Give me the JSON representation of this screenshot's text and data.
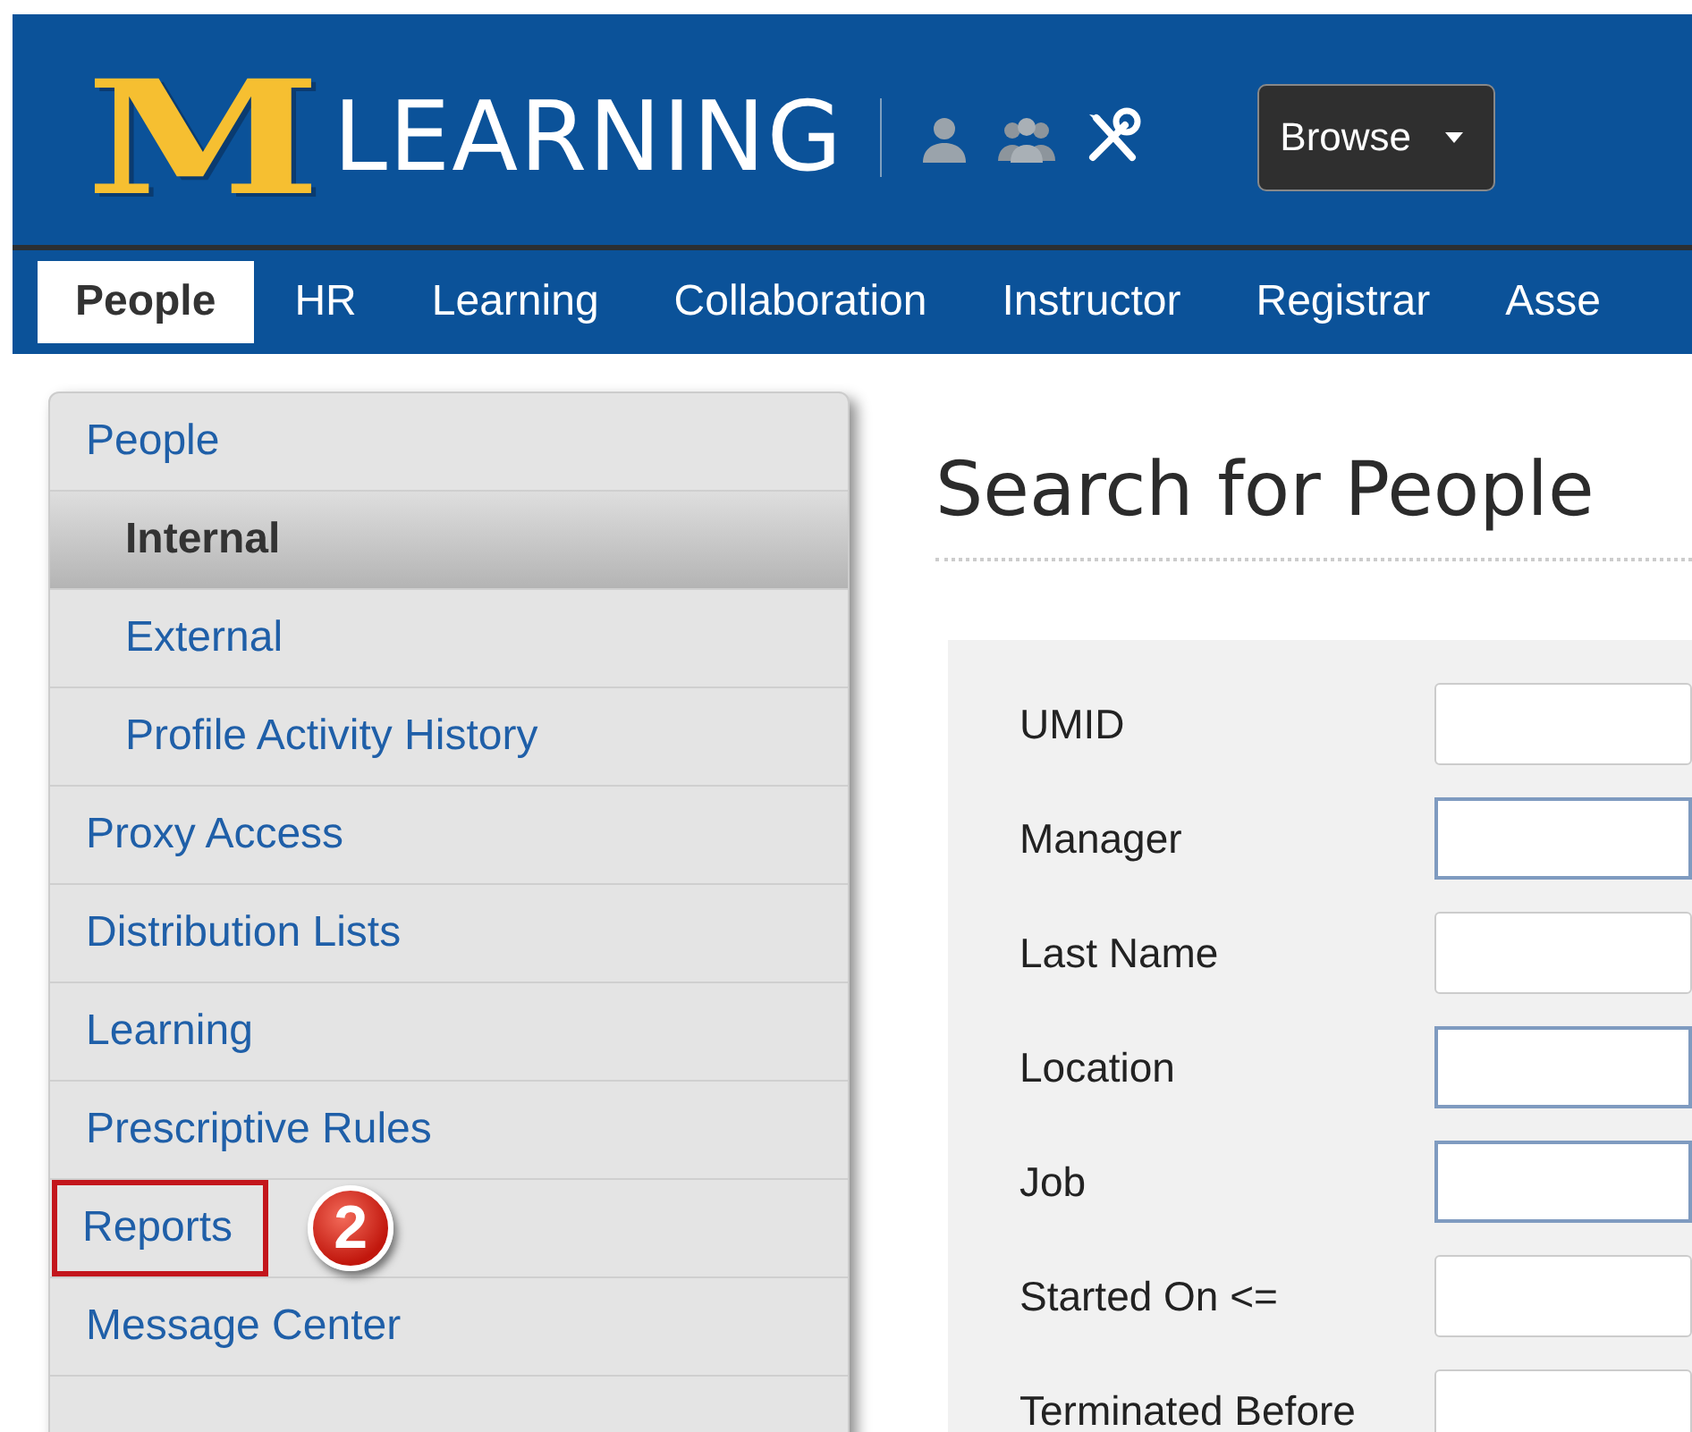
{
  "header": {
    "logo_mark": "M",
    "logo_text": "LEARNING",
    "browse_button": "Browse"
  },
  "tabs": [
    {
      "label": "People",
      "selected": true
    },
    {
      "label": "HR",
      "selected": false
    },
    {
      "label": "Learning",
      "selected": false
    },
    {
      "label": "Collaboration",
      "selected": false
    },
    {
      "label": "Instructor",
      "selected": false
    },
    {
      "label": "Registrar",
      "selected": false
    },
    {
      "label": "Asse",
      "selected": false
    }
  ],
  "sidebar": {
    "items": [
      {
        "label": "People",
        "selected": false,
        "highlighted": false,
        "children": [
          {
            "label": "Internal",
            "selected": true,
            "highlighted": false
          },
          {
            "label": "External",
            "selected": false,
            "highlighted": false
          },
          {
            "label": "Profile Activity History",
            "selected": false,
            "highlighted": false
          }
        ]
      },
      {
        "label": "Proxy Access",
        "selected": false,
        "highlighted": false
      },
      {
        "label": "Distribution Lists",
        "selected": false,
        "highlighted": false
      },
      {
        "label": "Learning",
        "selected": false,
        "highlighted": false
      },
      {
        "label": "Prescriptive Rules",
        "selected": false,
        "highlighted": false
      },
      {
        "label": "Reports",
        "selected": false,
        "highlighted": true,
        "callout": "2"
      },
      {
        "label": "Message Center",
        "selected": false,
        "highlighted": false
      }
    ]
  },
  "main": {
    "title": "Search for People",
    "fields": [
      {
        "label": "UMID",
        "kind": "text"
      },
      {
        "label": "Manager",
        "kind": "lookup"
      },
      {
        "label": "Last Name",
        "kind": "text"
      },
      {
        "label": "Location",
        "kind": "lookup"
      },
      {
        "label": "Job",
        "kind": "lookup"
      },
      {
        "label": "Started On <=",
        "kind": "text"
      },
      {
        "label": "Terminated Before",
        "kind": "text"
      }
    ]
  }
}
